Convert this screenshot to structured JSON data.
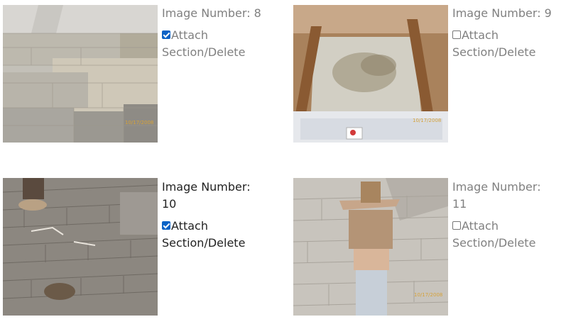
{
  "gallery": {
    "items": [
      {
        "label": "Image Number: 8",
        "attach_label": "Attach Section/Delete",
        "checked": true,
        "text_color": "#808080",
        "date_stamp": "10/17/2008"
      },
      {
        "label": "Image Number: 9",
        "attach_label": "Attach Section/Delete",
        "checked": false,
        "text_color": "#808080",
        "date_stamp": "10/17/2008"
      },
      {
        "label": "Image Number: 10",
        "attach_label": "Attach Section/Delete",
        "checked": true,
        "text_color": "#222222",
        "date_stamp": ""
      },
      {
        "label": "Image Number: 11",
        "attach_label": "Attach Section/Delete",
        "checked": false,
        "text_color": "#808080",
        "date_stamp": "10/17/2008"
      }
    ]
  },
  "colors": {
    "checkbox_checked": "#0b63c6",
    "checkbox_border": "#767676"
  }
}
